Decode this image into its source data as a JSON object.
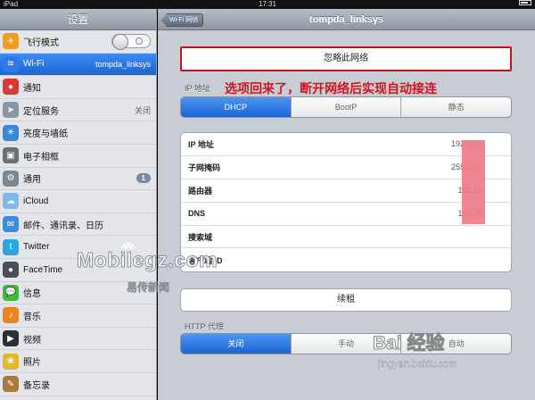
{
  "status_bar": {
    "device": "iPad",
    "time": "17:31"
  },
  "sidebar": {
    "title": "设置",
    "items": [
      {
        "label": "飞行模式",
        "value": "",
        "icon": "airplane-icon",
        "color": "#f39b1c",
        "glyph": "✈"
      },
      {
        "label": "Wi-Fi",
        "value": "tompda_linksys",
        "icon": "wifi-icon",
        "color": "#2c7ae8",
        "glyph": "≋"
      },
      {
        "label": "通知",
        "value": "",
        "icon": "notifications-icon",
        "color": "#d93a32",
        "glyph": "●"
      },
      {
        "label": "定位服务",
        "value": "关闭",
        "icon": "location-icon",
        "color": "#8a96a8",
        "glyph": "➤"
      },
      {
        "label": "亮度与墙纸",
        "value": "",
        "icon": "brightness-icon",
        "color": "#3a87d9",
        "glyph": "☀"
      },
      {
        "label": "电子相框",
        "value": "",
        "icon": "picture-frame-icon",
        "color": "#6b6f76",
        "glyph": "▣"
      },
      {
        "label": "通用",
        "value": "",
        "badge": "1",
        "icon": "gear-icon",
        "color": "#7d8590",
        "glyph": "⚙"
      },
      {
        "label": "iCloud",
        "value": "",
        "icon": "cloud-icon",
        "color": "#7fb7ea",
        "glyph": "☁"
      },
      {
        "label": "邮件、通讯录、日历",
        "value": "",
        "icon": "mail-icon",
        "color": "#3b8be0",
        "glyph": "✉"
      },
      {
        "label": "Twitter",
        "value": "",
        "icon": "twitter-icon",
        "color": "#2aa7e0",
        "glyph": "t"
      },
      {
        "label": "FaceTime",
        "value": "",
        "icon": "facetime-icon",
        "color": "#4a4f57",
        "glyph": "●"
      },
      {
        "label": "信息",
        "value": "",
        "icon": "messages-icon",
        "color": "#3dbb3a",
        "glyph": "💬"
      },
      {
        "label": "音乐",
        "value": "",
        "icon": "music-icon",
        "color": "#e8851e",
        "glyph": "♪"
      },
      {
        "label": "视频",
        "value": "",
        "icon": "video-icon",
        "color": "#2b2f36",
        "glyph": "▶"
      },
      {
        "label": "照片",
        "value": "",
        "icon": "photos-icon",
        "color": "#e3b82a",
        "glyph": "❀"
      },
      {
        "label": "备忘录",
        "value": "",
        "icon": "notes-icon",
        "color": "#a77a3c",
        "glyph": "✎"
      }
    ],
    "airplane_mode_on": false
  },
  "detail": {
    "back_label": "Wi-Fi 网络",
    "title": "tompda_linksys",
    "forget_label": "忽略此网络",
    "ip_section_title": "IP 地址",
    "annotation": "选项回来了，断开网络后实现自动接连",
    "ip_tabs": [
      "DHCP",
      "BootP",
      "静态"
    ],
    "ip_tab_selected": 0,
    "rows": [
      {
        "label": "IP 地址",
        "value": "192.168."
      },
      {
        "label": "子网掩码",
        "value": "255.255."
      },
      {
        "label": "路由器",
        "value": "192.16"
      },
      {
        "label": "DNS",
        "value": "192.16"
      },
      {
        "label": "搜索域",
        "value": ""
      },
      {
        "label": "客户端 ID",
        "value": ""
      }
    ],
    "renew_label": "续租",
    "proxy_section_title": "HTTP 代理",
    "proxy_tabs": [
      "关闭",
      "手动",
      "自动"
    ],
    "proxy_tab_selected": 0
  },
  "watermarks": {
    "mobilegz": "Mobilegz.com",
    "mobilegz_sub": "易传新闻",
    "baidu": "Bai 经验",
    "baidu_url": "jingyan.baidu.com"
  },
  "colors": {
    "accent": "#1b64d4",
    "annotation": "#d2141b",
    "redaction": "#f07b86"
  }
}
